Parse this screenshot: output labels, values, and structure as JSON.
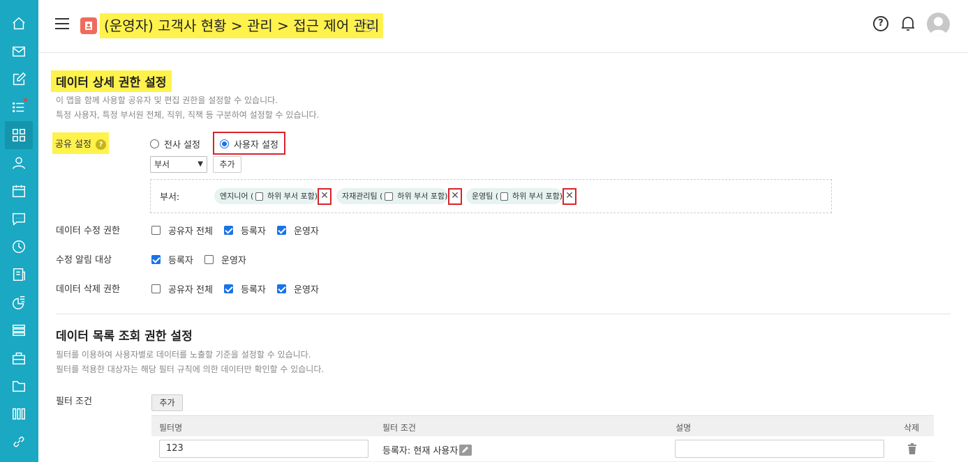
{
  "header": {
    "title": "(운영자) 고객사 현황 > 관리 > 접근 제어 관리",
    "info_icon": "info-icon",
    "help_glyph": "?"
  },
  "sidebar": {
    "items": [
      {
        "icon": "home-icon"
      },
      {
        "icon": "mail-icon"
      },
      {
        "icon": "edit-icon"
      },
      {
        "icon": "list-icon",
        "badge": true
      },
      {
        "icon": "apps-grid-icon",
        "active": true
      },
      {
        "icon": "person-icon"
      },
      {
        "icon": "calendar-icon"
      },
      {
        "icon": "chat-icon"
      },
      {
        "icon": "clock-icon"
      },
      {
        "icon": "board-icon"
      },
      {
        "icon": "report-icon"
      },
      {
        "icon": "stack-icon"
      },
      {
        "icon": "briefcase-icon"
      },
      {
        "icon": "folder-icon"
      },
      {
        "icon": "books-icon"
      },
      {
        "icon": "link-icon"
      }
    ]
  },
  "detail_section": {
    "title": "데이터 상세 권한 설정",
    "desc_line1": "이 앱을 함께 사용할 공유자 및 편집 권한을 설정할 수 있습니다.",
    "desc_line2": "특정 사용자, 특정 부서원 전체, 직위, 직책 등 구분하여 설정할 수 있습니다.",
    "share": {
      "label": "공유 설정",
      "help_glyph": "?",
      "option_all": "전사 설정",
      "option_user": "사용자 설정",
      "selected": "사용자 설정",
      "select_value": "부서",
      "add_button": "추가"
    },
    "dept": {
      "label": "부서:",
      "chips": [
        {
          "name": "엔지니어 (",
          "sub": "하위 부서 포함)"
        },
        {
          "name": "자재관리팀 (",
          "sub": "하위 부서 포함)"
        },
        {
          "name": "운영팀 (",
          "sub": "하위 부서 포함)"
        }
      ],
      "remove_glyph": "✕"
    },
    "edit_perm": {
      "label": "데이터 수정 권한",
      "options": [
        {
          "label": "공유자 전체",
          "checked": false
        },
        {
          "label": "등록자",
          "checked": true
        },
        {
          "label": "운영자",
          "checked": true
        }
      ]
    },
    "notify": {
      "label": "수정 알림 대상",
      "options": [
        {
          "label": "등록자",
          "checked": true
        },
        {
          "label": "운영자",
          "checked": false
        }
      ]
    },
    "delete_perm": {
      "label": "데이터 삭제 권한",
      "options": [
        {
          "label": "공유자 전체",
          "checked": false
        },
        {
          "label": "등록자",
          "checked": true
        },
        {
          "label": "운영자",
          "checked": true
        }
      ]
    }
  },
  "list_section": {
    "title": "데이터 목록 조회 권한 설정",
    "desc_line1": "필터를 이용하여 사용자별로 데이터를 노출할 기준을 설정할 수 있습니다.",
    "desc_line2": "필터를 적용한 대상자는 해당 필터 규칙에 의한 데이터만 확인할 수 있습니다.",
    "filter_label": "필터 조건",
    "add_button": "추가",
    "columns": [
      "필터명",
      "필터 조건",
      "설명",
      "삭제"
    ],
    "rows": [
      {
        "name": "123",
        "condition": "등록자: 현재 사용자",
        "description": ""
      }
    ]
  }
}
